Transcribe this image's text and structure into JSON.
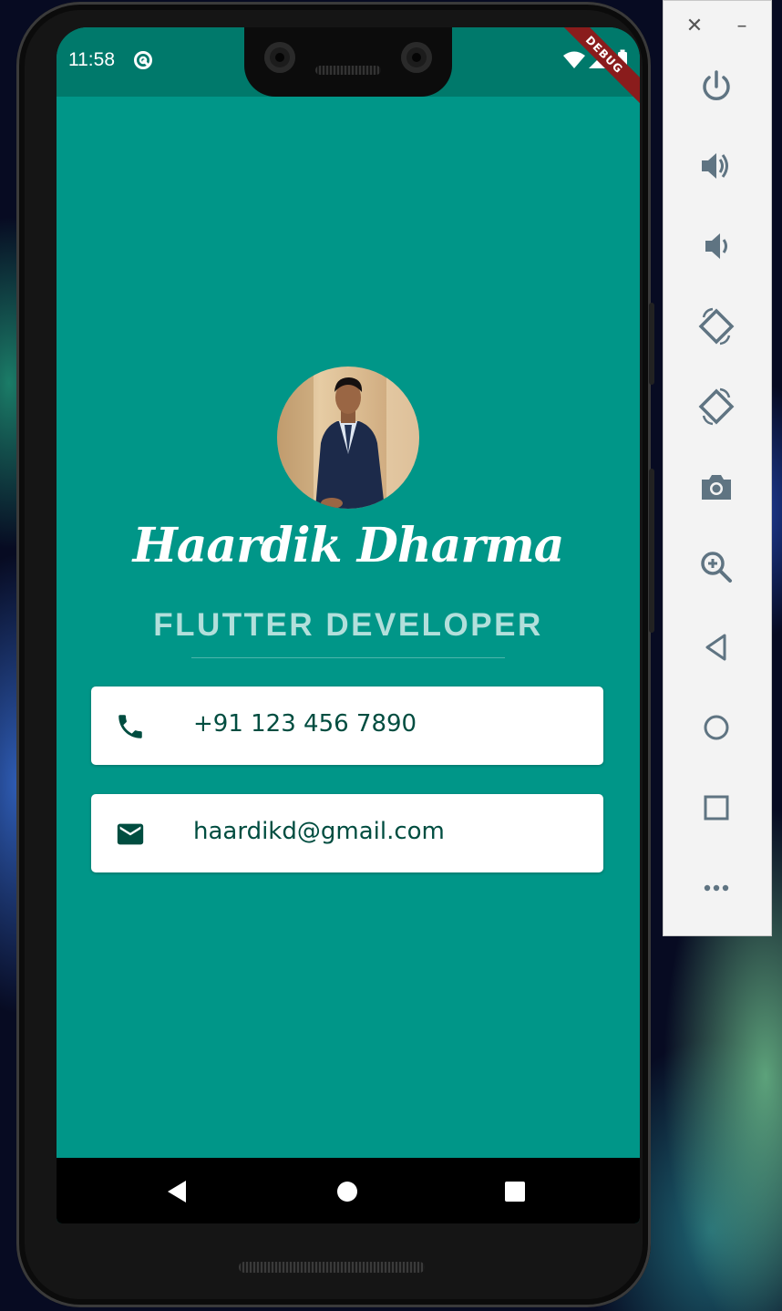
{
  "status_bar": {
    "time": "11:58",
    "debug_label": "DEBUG"
  },
  "profile": {
    "name": "Haardik Dharma",
    "title": "FLUTTER DEVELOPER"
  },
  "contacts": [
    {
      "icon": "phone-icon",
      "text": "+91 123 456 7890"
    },
    {
      "icon": "email-icon",
      "text": "haardikd@gmail.com"
    }
  ],
  "colors": {
    "background": "#009688",
    "status_bar": "#00796b",
    "card_text": "#004d40",
    "subtitle": "#b2dfdb"
  },
  "emulator_toolbar": {
    "buttons": [
      "power-icon",
      "volume-up-icon",
      "volume-down-icon",
      "rotate-left-icon",
      "rotate-right-icon",
      "camera-icon",
      "zoom-icon",
      "back-icon",
      "home-icon",
      "overview-icon",
      "more-icon"
    ]
  }
}
